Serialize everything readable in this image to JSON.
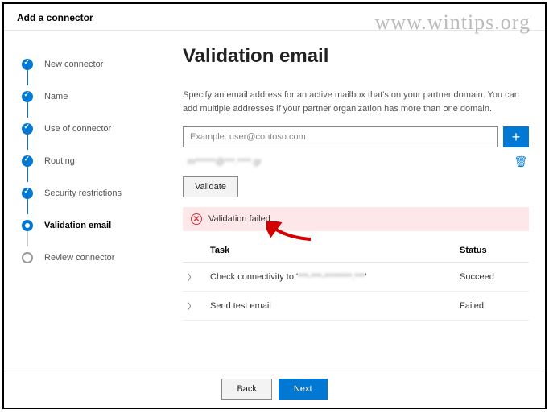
{
  "watermark": "www.wintips.org",
  "header": {
    "title": "Add a connector"
  },
  "steps": [
    {
      "label": "New connector",
      "state": "done"
    },
    {
      "label": "Name",
      "state": "done"
    },
    {
      "label": "Use of connector",
      "state": "done"
    },
    {
      "label": "Routing",
      "state": "done"
    },
    {
      "label": "Security restrictions",
      "state": "done"
    },
    {
      "label": "Validation email",
      "state": "active"
    },
    {
      "label": "Review connector",
      "state": "pending"
    }
  ],
  "main": {
    "title": "Validation email",
    "description": "Specify an email address for an active mailbox that's on your partner domain. You can add multiple addresses if your partner organization has more than one domain.",
    "input_placeholder": "Example: user@contoso.com",
    "added_email": "m******@***.****.gr",
    "validate_label": "Validate",
    "error_text": "Validation failed",
    "table": {
      "header_task": "Task",
      "header_status": "Status",
      "rows": [
        {
          "task_prefix": "Check connectivity to '",
          "task_blur": "***-***-********.***",
          "task_suffix": "'",
          "status": "Succeed"
        },
        {
          "task_prefix": "Send test email",
          "task_blur": "",
          "task_suffix": "",
          "status": "Failed"
        }
      ]
    }
  },
  "footer": {
    "back": "Back",
    "next": "Next"
  }
}
